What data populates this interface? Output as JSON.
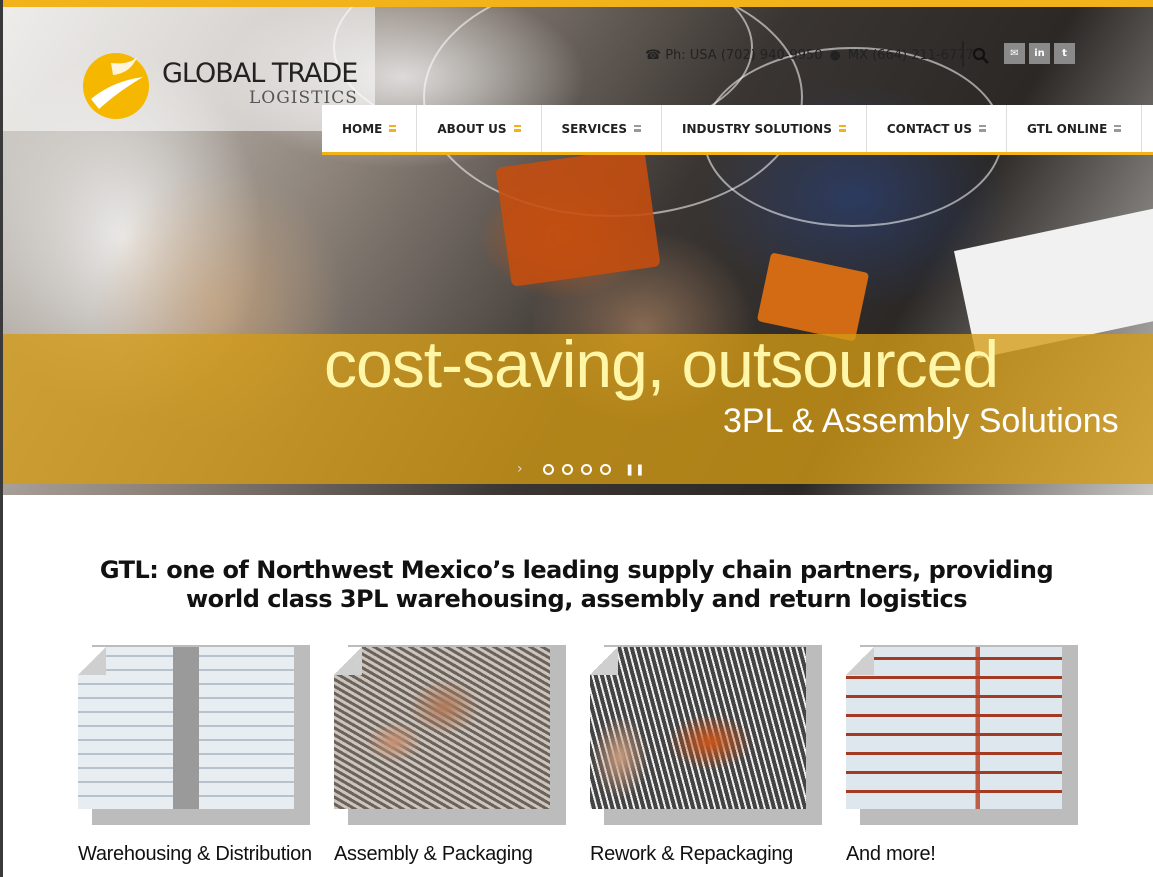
{
  "brand": {
    "name": "GLOBAL TRADE",
    "sub": "LOGISTICS",
    "accent_color": "#f2b31a"
  },
  "contact": {
    "phone_icon": "phone-icon",
    "usa": "Ph: USA (702) 940-9950",
    "mx": "MX (664) 211-6777"
  },
  "social": [
    {
      "name": "email-icon",
      "glyph": "✉"
    },
    {
      "name": "linkedin-icon",
      "glyph": "in"
    },
    {
      "name": "twitter-icon",
      "glyph": "t"
    }
  ],
  "nav": {
    "items": [
      {
        "label": "HOME"
      },
      {
        "label": "ABOUT US"
      },
      {
        "label": "SERVICES"
      },
      {
        "label": "INDUSTRY SOLUTIONS"
      },
      {
        "label": "CONTACT US"
      },
      {
        "label": "GTL ONLINE"
      }
    ]
  },
  "hero": {
    "headline": "cost-saving, outsourced",
    "subhead": "3PL & Assembly Solutions",
    "slide_count": 4,
    "current_slide": 1
  },
  "tagline": "GTL: one of Northwest Mexico’s leading supply chain partners, providing world class 3PL warehousing, assembly and return logistics",
  "cards": [
    {
      "label": "Warehousing & Distribution"
    },
    {
      "label": "Assembly & Packaging"
    },
    {
      "label": "Rework & Repackaging"
    },
    {
      "label": "And more!"
    }
  ]
}
